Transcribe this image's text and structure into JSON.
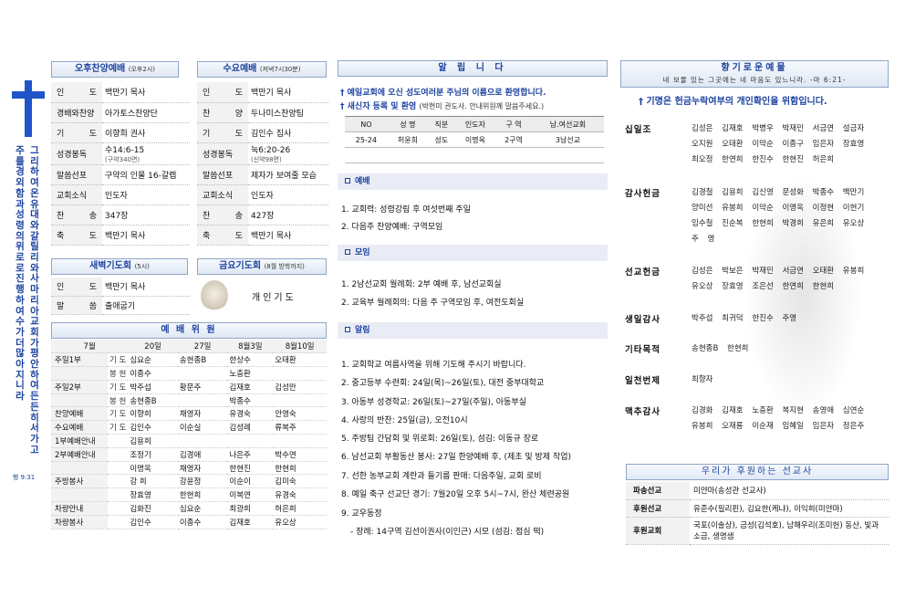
{
  "sidebar": {
    "verse_columns": [
      "그리하여 온 유대와 갈릴리와 사마리아 교회가 평안하여 든든히 서 가고",
      "주를 경외함과 성령의 위로로 진행하여 수가 더 많아지니라",
      "행 9:31"
    ]
  },
  "afternoon": {
    "title": "오후찬양예배",
    "time": "(오후2시)",
    "rows": [
      {
        "label": "인 도",
        "value": "백만기 목사"
      },
      {
        "label": "경배와찬양",
        "value": "아가토스찬양단"
      },
      {
        "label": "기 도",
        "value": "이향희 권사"
      },
      {
        "label": "성경봉독",
        "value": "수14:6-15",
        "note": "(구약340면)"
      },
      {
        "label": "말씀선포",
        "value": "구약의 인물 16-갈렙"
      },
      {
        "label": "교회소식",
        "value": "인도자"
      },
      {
        "label": "찬 송",
        "value": "347장"
      },
      {
        "label": "축 도",
        "value": "백만기 목사"
      }
    ]
  },
  "wednesday": {
    "title": "수요예배",
    "time": "(저녁7시30분)",
    "rows": [
      {
        "label": "인 도",
        "value": "백만기 목사"
      },
      {
        "label": "찬 양",
        "value": "두나미스찬양팀"
      },
      {
        "label": "기 도",
        "value": "김인수 집사"
      },
      {
        "label": "성경봉독",
        "value": "눅6:20-26",
        "note": "(신약98면)"
      },
      {
        "label": "말씀선포",
        "value": "제자가 보여줄 모습"
      },
      {
        "label": "교회소식",
        "value": "인도자"
      },
      {
        "label": "찬 송",
        "value": "427장"
      },
      {
        "label": "축 도",
        "value": "백만기 목사"
      }
    ]
  },
  "dawn": {
    "title": "새벽기도회",
    "time": "(5시)",
    "rows": [
      {
        "label": "인 도",
        "value": "백만기 목사"
      },
      {
        "label": "말 씀",
        "value": "출애굽기"
      }
    ]
  },
  "friday": {
    "title": "금요기도회",
    "time": "(8월 방학까지)",
    "text": "개인기도"
  },
  "committee": {
    "title": "예 배 위 원",
    "header": [
      "7월",
      "20일",
      "27일",
      "8월3일",
      "8월10일"
    ],
    "rows": [
      {
        "role": "주일1부",
        "sub": "기 도",
        "cells": [
          "심요순",
          "송현종B",
          "한상수",
          "오태환"
        ]
      },
      {
        "role": "",
        "sub": "봉 헌",
        "cells": [
          "이종수",
          "",
          "노충환",
          ""
        ]
      },
      {
        "role": "주일2부",
        "sub": "기 도",
        "cells": [
          "박주섭",
          "황문주",
          "김재호",
          "김성만"
        ]
      },
      {
        "role": "",
        "sub": "봉 헌",
        "cells": [
          "송현종B",
          "",
          "박종수",
          ""
        ]
      },
      {
        "role": "찬양예배",
        "sub": "기 도",
        "cells": [
          "이향희",
          "채영자",
          "유경숙",
          "안영숙"
        ]
      },
      {
        "role": "수요예배",
        "sub": "기 도",
        "cells": [
          "김인수",
          "이순실",
          "김성례",
          "류복주"
        ]
      },
      {
        "role": "1부예배안내",
        "sub": "",
        "cells": [
          "김용희",
          "",
          "",
          ""
        ]
      },
      {
        "role": "2부예배안내",
        "sub": "",
        "cells": [
          "조정기",
          "김경애",
          "나은주",
          "박수연"
        ]
      },
      {
        "role": "",
        "sub": "",
        "cells": [
          "이명옥",
          "채영자",
          "한현진",
          "한현희"
        ]
      },
      {
        "role": "주방봉사",
        "sub": "",
        "cells": [
          "강 희",
          "강윤정",
          "이순이",
          "김미숙"
        ]
      },
      {
        "role": "",
        "sub": "",
        "cells": [
          "장효영",
          "한현희",
          "이복연",
          "유경숙"
        ]
      },
      {
        "role": "차량안내",
        "sub": "",
        "cells": [
          "김화진",
          "심요순",
          "최광희",
          "허은희"
        ]
      },
      {
        "role": "차량봉사",
        "sub": "",
        "cells": [
          "김인수",
          "이종수",
          "김재호",
          "유오상"
        ]
      }
    ]
  },
  "notices": {
    "title": "알 립 니 다",
    "welcome1": "예일교회에 오신 성도여러분 주님의 이름으로 환영합니다.",
    "welcome2": "새신자 등록 및 환영",
    "welcome2_note": "(박현미 권도사. 안내위원께 말씀주세요.)",
    "newcomer_header": [
      "NO",
      "성 명",
      "직분",
      "인도자",
      "구 역",
      "남.여선교회"
    ],
    "newcomer_rows": [
      [
        "25-24",
        "허윤희",
        "성도",
        "이명옥",
        "2구역",
        "3남선교"
      ]
    ],
    "sections": [
      {
        "title": "예배",
        "items": [
          "1. 교회력: 성령강림 후 여섯번째 주일",
          "2. 다음주 찬양예배: 구역모임"
        ]
      },
      {
        "title": "모임",
        "items": [
          "1. 2남선교회 월례회: 2부 예배 후, 남선교회실",
          "2. 교육부 월례회의: 다음 주 구역모임 후, 여전도회실"
        ]
      },
      {
        "title": "알림",
        "items": [
          "1. 교회학교 여름사역을 위해 기도해 주시기 바랍니다.",
          "2. 중고등부 수련회: 24일(목)~26일(토), 대전 중부대학교",
          "3. 아동부 성경학교: 26일(토)~27일(주일), 아동부실",
          "4. 사랑의 반찬: 25일(금), 오전10시",
          "5. 주방팀 간담회 및 위로회: 26일(토), 섬김: 이동규 장로",
          "6. 남선교회 부활동산 봉사: 27일 한양예배 후, (제초 및 방제 작업)",
          "7. 선한 농부교회 계란과 들기름 판매: 다음주일, 교회 로비",
          "8. 예일 축구 선교단 경기: 7월20일 오후 5시~7시, 완산 체련공원",
          "9. 교우동정",
          "- 장례: 14구역 김선이권사(이인근) 시모 (섬김: 점심 떡)"
        ]
      }
    ]
  },
  "offering": {
    "title": "향기로운예물",
    "verse": "네 보물 있는 그곳에는 네 마음도 있느니라. -마 6:21-",
    "subtitle": "기명은 헌금누락여부의 개인확인을 위함입니다.",
    "groups": [
      {
        "label": "십일조",
        "names": [
          "김성은 김재호 박병우 박재민 서금연 설금자",
          "오지원 오태환 이막순 이종구 임은자 장효영",
          "최오정 한연희 한진수 한현진 허은희"
        ]
      },
      {
        "label": "감사헌금",
        "names": [
          "김경철 김용희 김신영 문성화 박종수 백만기",
          "양미선 유봉희 이막순 이영옥 이정현 이현기",
          "임수철 진순복 한현희 박경희 유은희 유오상",
          "주 영"
        ]
      },
      {
        "label": "선교헌금",
        "names": [
          "김성은 박보은 박재민 서금연 오태환 유봉희",
          "유오상 장효영 조은선 한연희 한현희"
        ]
      },
      {
        "label": "생일감사",
        "names": [
          "박주섭 최귀덕 한진수 주영"
        ]
      },
      {
        "label": "기타목적",
        "names": [
          "송현종B 한현희"
        ]
      },
      {
        "label": "일천번제",
        "names": [
          "최향자"
        ]
      },
      {
        "label": "맥추감사",
        "names": [
          "김경화 김재호 노충환 복지현 송영애 심연순",
          "유봉희 오재룡 이순재 임혜일 임은자 정은주"
        ]
      }
    ]
  },
  "missionary": {
    "title": "우리가 후원하는 선교사",
    "rows": [
      {
        "label": "파송선교",
        "value": "미얀마(송성관 선교사)"
      },
      {
        "label": "후원선교",
        "value": "유준수(필리핀), 김요한(케냐), 이익희(미얀마)"
      },
      {
        "label": "후원교회",
        "value": "국포(이솔상), 금성(김석호), 남해우리(조미헌) 동산, 빛과소금, 생명샘"
      }
    ]
  }
}
